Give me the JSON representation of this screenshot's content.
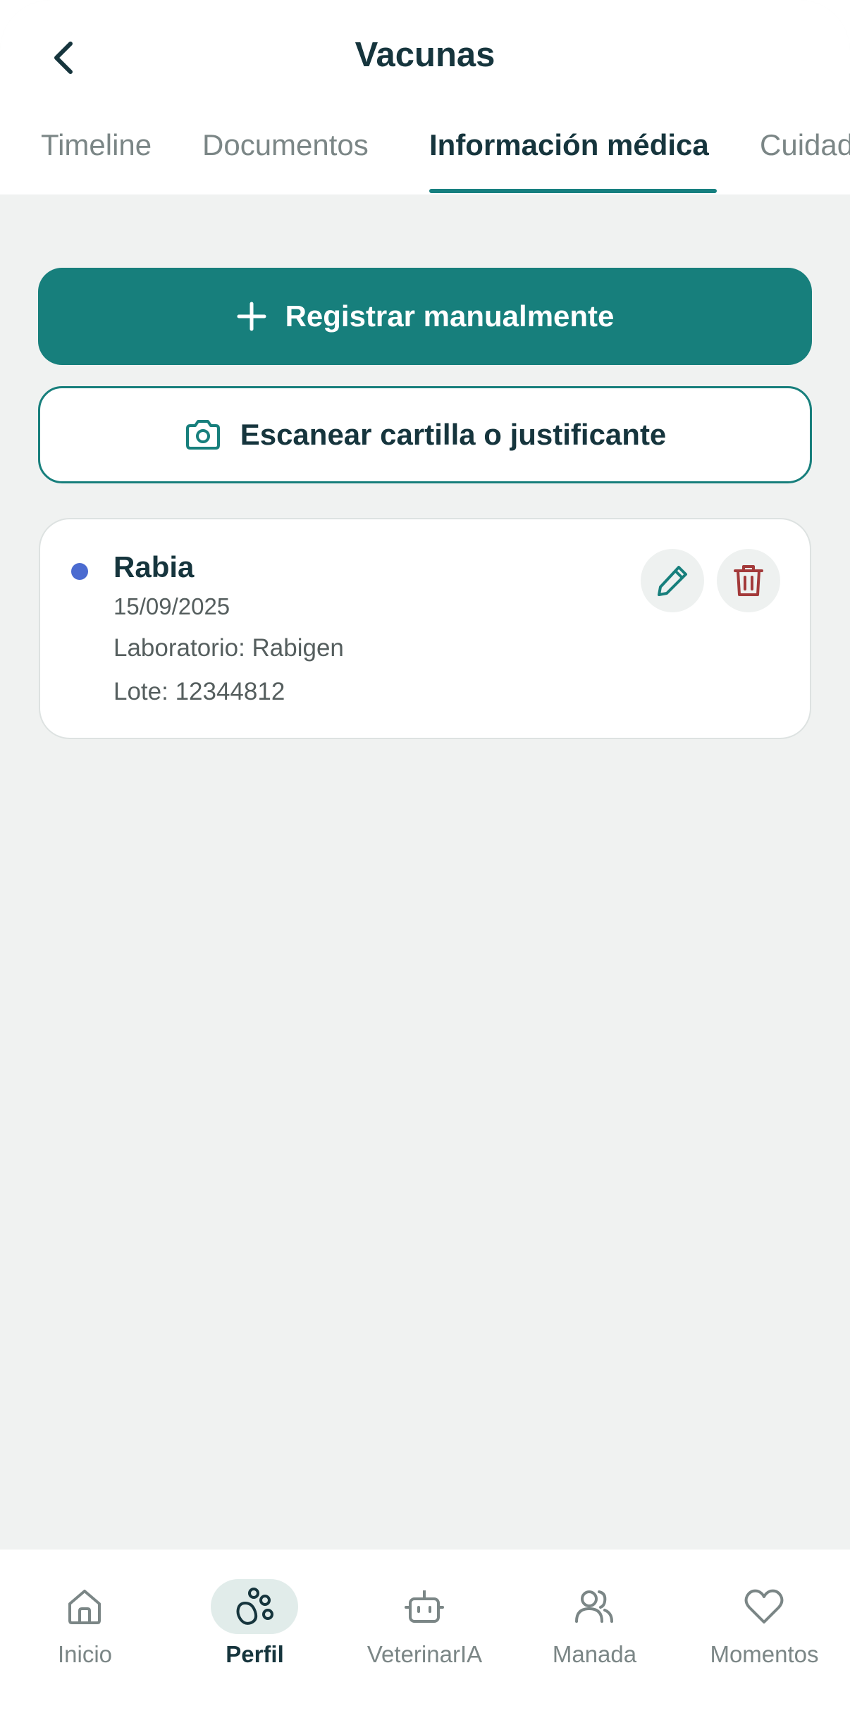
{
  "header": {
    "title": "Vacunas",
    "back_icon": "chevron-left-icon"
  },
  "tabs": [
    {
      "label": "Timeline",
      "active": false
    },
    {
      "label": "Documentos",
      "active": false
    },
    {
      "label": "Información médica",
      "active": true
    },
    {
      "label": "Cuidados",
      "active": false
    }
  ],
  "actions": {
    "register_label": "Registrar manualmente",
    "register_icon": "plus-icon",
    "scan_label": "Escanear cartilla o justificante",
    "scan_icon": "camera-icon"
  },
  "vaccines": [
    {
      "name": "Rabia",
      "date": "15/09/2025",
      "lab": "Laboratorio: Rabigen",
      "lot": "Lote: 12344812",
      "dot_color": "#4b6bd0"
    }
  ],
  "bottom_nav": [
    {
      "label": "Inicio",
      "icon": "home-icon",
      "active": false
    },
    {
      "label": "Perfil",
      "icon": "paw-icon",
      "active": true
    },
    {
      "label": "VeterinarIA",
      "icon": "robot-icon",
      "active": false
    },
    {
      "label": "Manada",
      "icon": "users-icon",
      "active": false
    },
    {
      "label": "Momentos",
      "icon": "heart-icon",
      "active": false
    }
  ],
  "colors": {
    "primary": "#177f7c",
    "dark_text": "#16353d",
    "muted_text": "#7b8686",
    "background": "#f0f2f1",
    "delete": "#a33a3a"
  }
}
